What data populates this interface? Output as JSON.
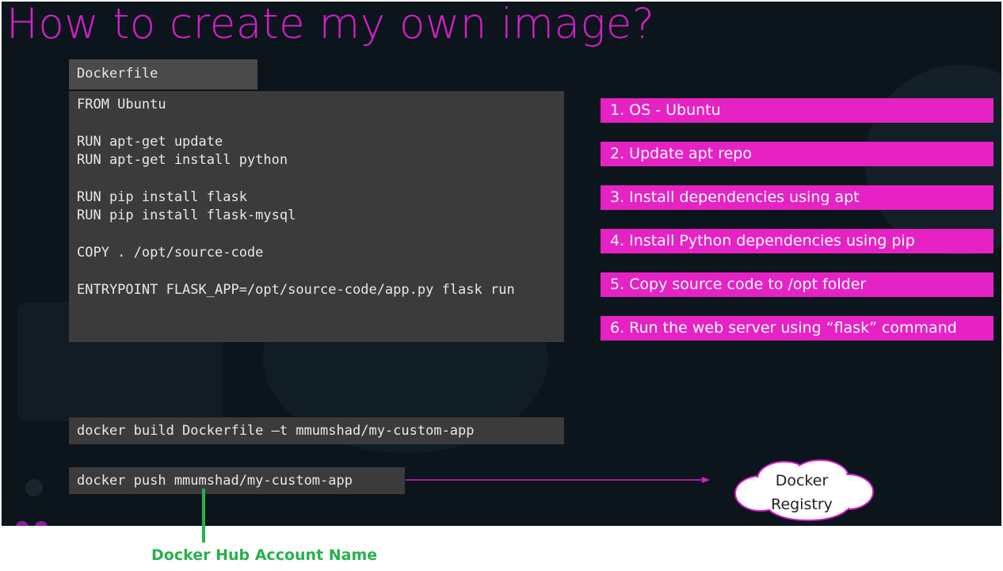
{
  "slide": {
    "title": "How to create my own image?",
    "dockerfile": {
      "tab_label": "Dockerfile",
      "lines": [
        "FROM Ubuntu",
        "",
        "RUN apt-get update",
        "RUN apt-get install python",
        "",
        "RUN pip install flask",
        "RUN pip install flask-mysql",
        "",
        "COPY . /opt/source-code",
        "",
        "ENTRYPOINT FLASK_APP=/opt/source-code/app.py flask run"
      ]
    },
    "steps": [
      "1. OS - Ubuntu",
      "2. Update apt repo",
      "3. Install dependencies using apt",
      "4. Install Python dependencies using pip",
      "5. Copy source code to /opt folder",
      "6. Run the web server using “flask” command"
    ],
    "build_command": "docker build Dockerfile –t mmumshad/my-custom-app",
    "push_command": "docker push mmumshad/my-custom-app",
    "registry": {
      "line1": "Docker",
      "line2": "Registry"
    }
  },
  "annotation": {
    "label": "Docker Hub Account Name"
  },
  "colors": {
    "title": "#d61ecb",
    "step_bg": "#e622c5",
    "annotation": "#27b14b",
    "slide_bg": "#0c151b",
    "code_bg": "#3b3b3b"
  }
}
